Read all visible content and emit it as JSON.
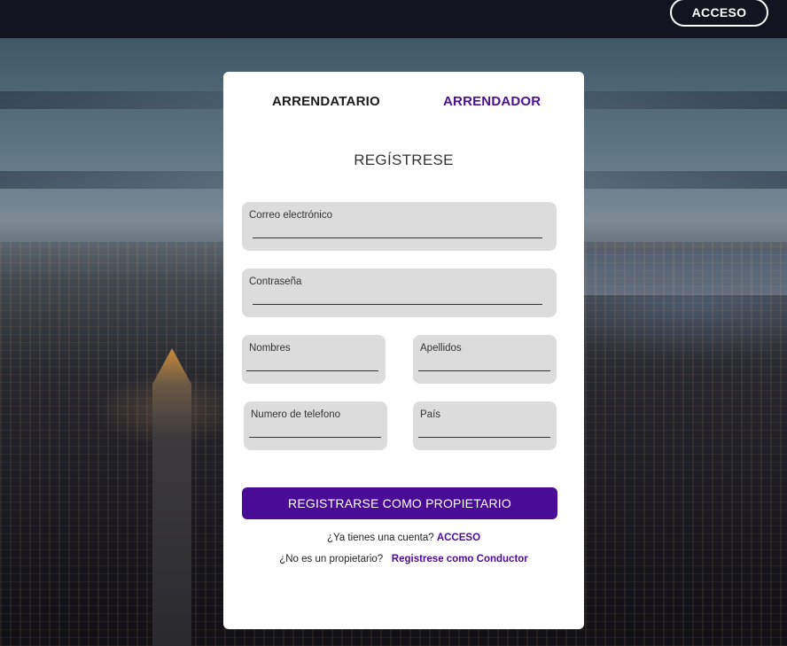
{
  "header": {
    "login_label": "ACCESO"
  },
  "tabs": [
    {
      "label": "ARRENDATARIO",
      "active": false
    },
    {
      "label": "ARRENDADOR",
      "active": true
    }
  ],
  "form": {
    "title": "REGÍSTRESE",
    "email_label": "Correo electrónico",
    "password_label": "Contraseña",
    "first_name_label": "Nombres",
    "last_name_label": "Apellidos",
    "phone_label": "Numero de telefono",
    "country_label": "País",
    "submit_label": "REGISTRARSE COMO  PROPIETARIO"
  },
  "footer": {
    "have_account_text": "¿Ya tienes una cuenta?",
    "have_account_link": "ACCESO",
    "not_owner_text": "¿No  es un propietario?",
    "not_owner_link": "Registrese como Conductor"
  },
  "colors": {
    "accent": "#4a0b96",
    "topbar": "#141421",
    "field_bg": "#dcdcdc"
  }
}
